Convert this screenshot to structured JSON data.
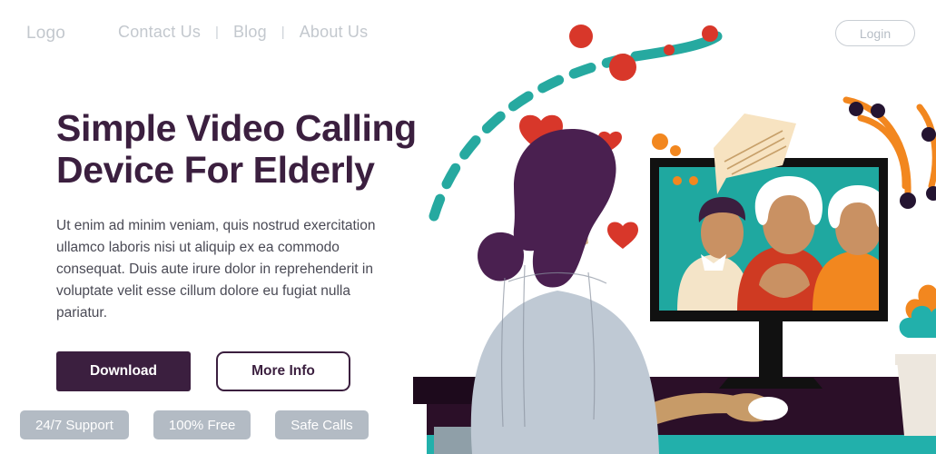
{
  "nav": {
    "logo": "Logo",
    "links": [
      {
        "label": "Contact Us"
      },
      {
        "label": "Blog"
      },
      {
        "label": "About Us"
      }
    ],
    "separator": "|",
    "login_label": "Login"
  },
  "hero": {
    "headline_line1": "Simple Video Calling",
    "headline_line2": "Device For Elderly",
    "paragraph": "Ut enim ad minim veniam, quis nostrud exercitation ullamco laboris nisi ut aliquip ex ea commodo consequat. Duis aute irure dolor in reprehenderit in voluptate velit esse cillum dolore eu fugiat nulla pariatur.",
    "primary_cta": "Download",
    "secondary_cta": "More Info"
  },
  "tags": [
    {
      "label": "24/7 Support"
    },
    {
      "label": "100% Free"
    },
    {
      "label": "Safe Calls"
    }
  ],
  "colors": {
    "heading_purple": "#3b1f3f",
    "nav_gray": "#c3c8ce",
    "body_text": "#4a4a55",
    "tag_gray": "#b3bbc4",
    "teal": "#26a9a0",
    "red": "#d8372a",
    "orange": "#f2871f",
    "cream": "#f7e3c1",
    "shirt_blue": "#bfc9d4",
    "skin": "#d6b78a",
    "desk_dark": "#2b0f28",
    "background": "#ffffff"
  },
  "illustration": {
    "scene_name": "elderly-video-call-scene",
    "foreground_person": "woman-back-view-purple-hair",
    "monitor_participants": [
      "young-person-cream-shirt",
      "elder-red-sweater",
      "elder-orange-cardigan"
    ],
    "decor": [
      "teal-dashed-arc",
      "red-dots",
      "orange-dots",
      "red-hearts",
      "speech-bubble",
      "orange-signal-arcs",
      "potted-plant",
      "computer-mouse"
    ]
  }
}
